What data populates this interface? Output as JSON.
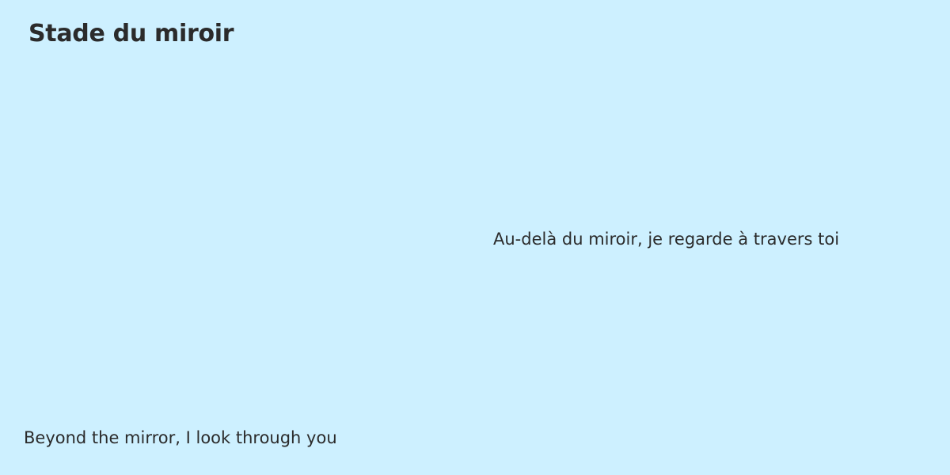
{
  "title": "Stade du miroir",
  "lines": {
    "french": "Au-delà du miroir, je regarde à travers toi",
    "english": "Beyond the mirror, I look through you"
  },
  "colors": {
    "background": "#cdf0ff",
    "text": "#2b2b2b"
  }
}
